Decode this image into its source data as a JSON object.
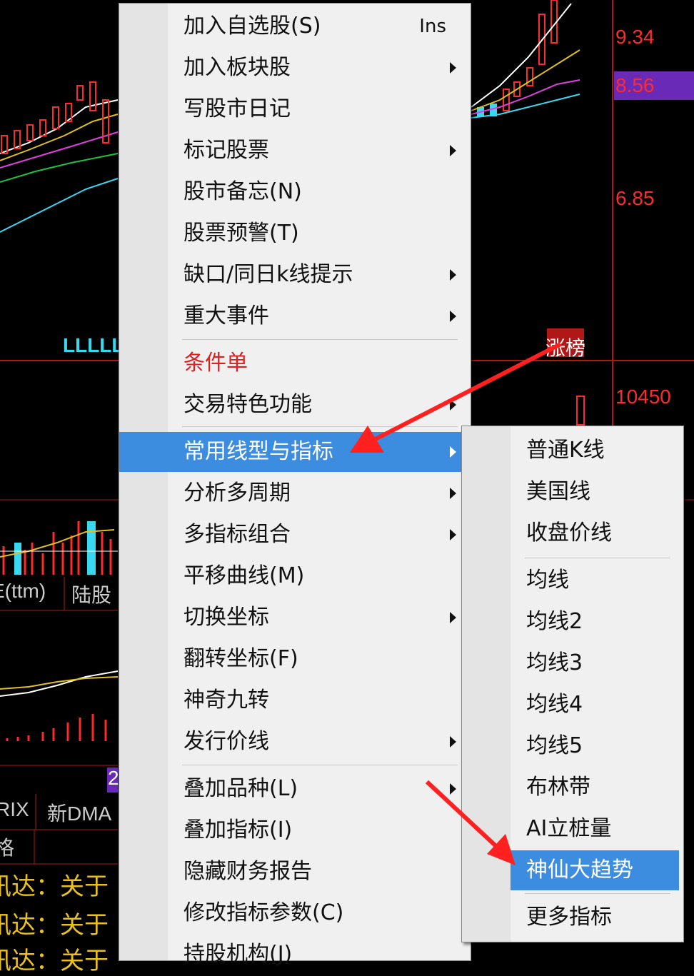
{
  "background": {
    "price_labels": [
      "9.34",
      "8.56",
      "6.85",
      "10450"
    ],
    "tag_text": "涨榜",
    "left_labels": [
      "LLLLL",
      "E(ttm)",
      "陆股",
      "RIX",
      "新DMA",
      "格",
      "讯达：关于",
      "讯达：关于",
      "讯达：关于",
      "2"
    ]
  },
  "main_menu": {
    "items": [
      {
        "label": "加入自选股(S)",
        "shortcut": "Ins",
        "submenu": false
      },
      {
        "label": "加入板块股",
        "submenu": true
      },
      {
        "label": "写股市日记",
        "submenu": false
      },
      {
        "label": "标记股票",
        "submenu": true
      },
      {
        "label": "股市备忘(N)",
        "submenu": false
      },
      {
        "label": "股票预警(T)",
        "submenu": false
      },
      {
        "label": "缺口/同日k线提示",
        "submenu": true
      },
      {
        "label": "重大事件",
        "submenu": true
      },
      {
        "label": "条件单",
        "submenu": false
      },
      {
        "label": "交易特色功能",
        "submenu": true
      },
      {
        "label": "常用线型与指标",
        "submenu": true
      },
      {
        "label": "分析多周期",
        "submenu": true
      },
      {
        "label": "多指标组合",
        "submenu": true
      },
      {
        "label": "平移曲线(M)",
        "submenu": false
      },
      {
        "label": "切换坐标",
        "submenu": true
      },
      {
        "label": "翻转坐标(F)",
        "submenu": false
      },
      {
        "label": "神奇九转",
        "submenu": false
      },
      {
        "label": "发行价线",
        "submenu": true
      },
      {
        "label": "叠加品种(L)",
        "submenu": true
      },
      {
        "label": "叠加指标(I)",
        "submenu": false
      },
      {
        "label": "隐藏财务报告",
        "submenu": false
      },
      {
        "label": "修改指标参数(C)",
        "submenu": false
      },
      {
        "label": "持股机构(J)",
        "submenu": false
      }
    ]
  },
  "sub_menu": {
    "items": [
      {
        "label": "普通K线"
      },
      {
        "label": "美国线"
      },
      {
        "label": "收盘价线"
      },
      {
        "label": "均线"
      },
      {
        "label": "均线2"
      },
      {
        "label": "均线3"
      },
      {
        "label": "均线4"
      },
      {
        "label": "均线5"
      },
      {
        "label": "布林带"
      },
      {
        "label": "AI立桩量"
      },
      {
        "label": "神仙大趋势"
      },
      {
        "label": "更多指标"
      }
    ]
  },
  "colors": {
    "highlight": "#3c8ce0",
    "arrow": "#ff2020",
    "chart_red": "#ff2a2a",
    "chart_cyan": "#39d8f0"
  }
}
